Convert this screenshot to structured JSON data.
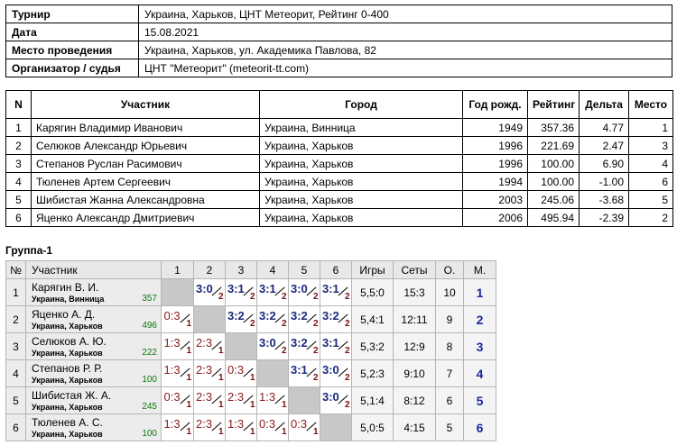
{
  "info": [
    {
      "label": "Турнир",
      "value": "Украина, Харьков, ЦНТ Метеорит, Рейтинг 0-400"
    },
    {
      "label": "Дата",
      "value": "15.08.2021"
    },
    {
      "label": "Место проведения",
      "value": "Украина, Харьков, ул. Академика Павлова, 82"
    },
    {
      "label": "Организатор / судья",
      "value": "ЦНТ \"Метеорит\" (meteorit-tt.com)"
    }
  ],
  "players_table": {
    "headers": [
      "N",
      "Участник",
      "Город",
      "Год рожд.",
      "Рейтинг",
      "Дельта",
      "Место"
    ],
    "rows": [
      [
        "1",
        "Карягин Владимир Иванович",
        "Украина, Винница",
        "1949",
        "357.36",
        "4.77",
        "1"
      ],
      [
        "2",
        "Селюков Александр Юрьевич",
        "Украина, Харьков",
        "1996",
        "221.69",
        "2.47",
        "3"
      ],
      [
        "3",
        "Степанов Руслан Расимович",
        "Украина, Харьков",
        "1996",
        "100.00",
        "6.90",
        "4"
      ],
      [
        "4",
        "Тюленев Артем Сергеевич",
        "Украина, Харьков",
        "1994",
        "100.00",
        "-1.00",
        "6"
      ],
      [
        "5",
        "Шибистая Жанна Александровна",
        "Украина, Харьков",
        "2003",
        "245.06",
        "-3.68",
        "5"
      ],
      [
        "6",
        "Яценко Александр Дмитриевич",
        "Украина, Харьков",
        "2006",
        "495.94",
        "-2.39",
        "2"
      ]
    ]
  },
  "group": {
    "title": "Группа-1",
    "headers": [
      "№",
      "Участник",
      "1",
      "2",
      "3",
      "4",
      "5",
      "6",
      "Игры",
      "Сеты",
      "О.",
      "М."
    ],
    "rows": [
      {
        "n": "1",
        "name": "Карягин В. И.",
        "city": "Украина, Винница",
        "rating": "357",
        "cells": [
          null,
          {
            "s": "3:0",
            "p": "2",
            "w": true
          },
          {
            "s": "3:1",
            "p": "2",
            "w": true
          },
          {
            "s": "3:1",
            "p": "2",
            "w": true
          },
          {
            "s": "3:0",
            "p": "2",
            "w": true
          },
          {
            "s": "3:1",
            "p": "2",
            "w": true
          }
        ],
        "games": "5,5:0",
        "sets": "15:3",
        "points": "10",
        "place": "1"
      },
      {
        "n": "2",
        "name": "Яценко А. Д.",
        "city": "Украина, Харьков",
        "rating": "496",
        "cells": [
          {
            "s": "0:3",
            "p": "1",
            "w": false
          },
          null,
          {
            "s": "3:2",
            "p": "2",
            "w": true
          },
          {
            "s": "3:2",
            "p": "2",
            "w": true
          },
          {
            "s": "3:2",
            "p": "2",
            "w": true
          },
          {
            "s": "3:2",
            "p": "2",
            "w": true
          }
        ],
        "games": "5,4:1",
        "sets": "12:11",
        "points": "9",
        "place": "2"
      },
      {
        "n": "3",
        "name": "Селюков А. Ю.",
        "city": "Украина, Харьков",
        "rating": "222",
        "cells": [
          {
            "s": "1:3",
            "p": "1",
            "w": false
          },
          {
            "s": "2:3",
            "p": "1",
            "w": false
          },
          null,
          {
            "s": "3:0",
            "p": "2",
            "w": true
          },
          {
            "s": "3:2",
            "p": "2",
            "w": true
          },
          {
            "s": "3:1",
            "p": "2",
            "w": true
          }
        ],
        "games": "5,3:2",
        "sets": "12:9",
        "points": "8",
        "place": "3"
      },
      {
        "n": "4",
        "name": "Степанов Р. Р.",
        "city": "Украина, Харьков",
        "rating": "100",
        "cells": [
          {
            "s": "1:3",
            "p": "1",
            "w": false
          },
          {
            "s": "2:3",
            "p": "1",
            "w": false
          },
          {
            "s": "0:3",
            "p": "1",
            "w": false
          },
          null,
          {
            "s": "3:1",
            "p": "2",
            "w": true
          },
          {
            "s": "3:0",
            "p": "2",
            "w": true
          }
        ],
        "games": "5,2:3",
        "sets": "9:10",
        "points": "7",
        "place": "4"
      },
      {
        "n": "5",
        "name": "Шибистая Ж. А.",
        "city": "Украина, Харьков",
        "rating": "245",
        "cells": [
          {
            "s": "0:3",
            "p": "1",
            "w": false
          },
          {
            "s": "2:3",
            "p": "1",
            "w": false
          },
          {
            "s": "2:3",
            "p": "1",
            "w": false
          },
          {
            "s": "1:3",
            "p": "1",
            "w": false
          },
          null,
          {
            "s": "3:0",
            "p": "2",
            "w": true
          }
        ],
        "games": "5,1:4",
        "sets": "8:12",
        "points": "6",
        "place": "5"
      },
      {
        "n": "6",
        "name": "Тюленев А. С.",
        "city": "Украина, Харьков",
        "rating": "100",
        "cells": [
          {
            "s": "1:3",
            "p": "1",
            "w": false
          },
          {
            "s": "2:3",
            "p": "1",
            "w": false
          },
          {
            "s": "1:3",
            "p": "1",
            "w": false
          },
          {
            "s": "0:3",
            "p": "1",
            "w": false
          },
          {
            "s": "0:3",
            "p": "1",
            "w": false
          },
          null
        ],
        "games": "5,0:5",
        "sets": "4:15",
        "points": "5",
        "place": "6"
      }
    ]
  }
}
